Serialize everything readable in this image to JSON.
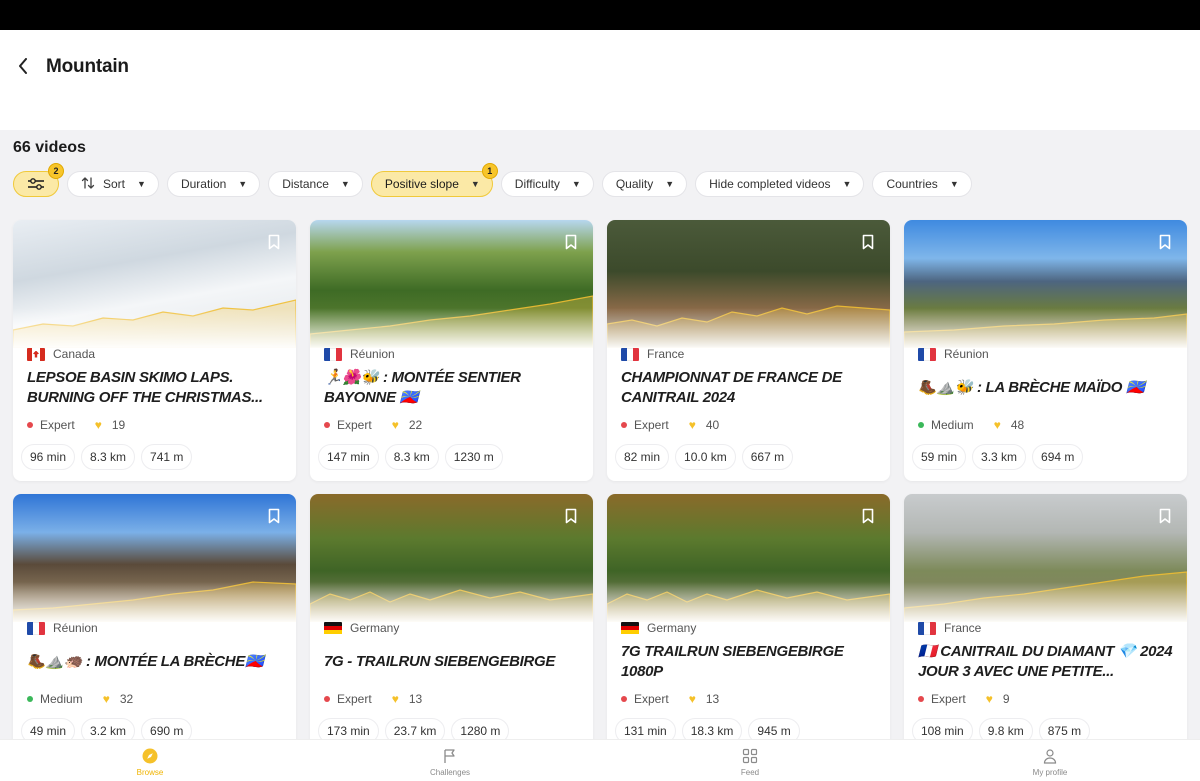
{
  "header": {
    "title": "Mountain"
  },
  "video_count": "66 videos",
  "filters": {
    "settings_badge": "2",
    "chips": [
      {
        "label": "Sort",
        "has_sort_icon": true
      },
      {
        "label": "Duration"
      },
      {
        "label": "Distance"
      },
      {
        "label": "Positive slope",
        "active": true,
        "badge": "1"
      },
      {
        "label": "Difficulty"
      },
      {
        "label": "Quality"
      },
      {
        "label": "Hide completed videos"
      },
      {
        "label": "Countries"
      }
    ]
  },
  "cards": [
    {
      "country": "Canada",
      "flag": "canada",
      "title": "LEPSOE BASIN SKIMO LAPS. BURNING OFF THE CHRISTMAS...",
      "difficulty": "Expert",
      "likes": "19",
      "duration": "96 min",
      "distance": "8.3 km",
      "elevation": "741 m",
      "scene": "snow"
    },
    {
      "country": "Réunion",
      "flag": "france",
      "title": "🏃🌺🐝 : MONTÉE SENTIER BAYONNE 🇷🇪",
      "difficulty": "Expert",
      "likes": "22",
      "duration": "147 min",
      "distance": "8.3 km",
      "elevation": "1230 m",
      "scene": "jungle"
    },
    {
      "country": "France",
      "flag": "france",
      "title": "CHAMPIONNAT DE FRANCE DE CANITRAIL 2024",
      "difficulty": "Expert",
      "likes": "40",
      "duration": "82 min",
      "distance": "10.0 km",
      "elevation": "667 m",
      "scene": "trail"
    },
    {
      "country": "Réunion",
      "flag": "france",
      "title": "🥾⛰️🐝 : LA BRÈCHE MAÏDO 🇷🇪",
      "difficulty": "Medium",
      "likes": "48",
      "duration": "59 min",
      "distance": "3.3 km",
      "elevation": "694 m",
      "scene": "ridge"
    },
    {
      "country": "Réunion",
      "flag": "france",
      "title": "🥾⛰️🦔 : MONTÉE LA BRÈCHE🇷🇪",
      "difficulty": "Medium",
      "likes": "32",
      "duration": "49 min",
      "distance": "3.2 km",
      "elevation": "690 m",
      "scene": "rock"
    },
    {
      "country": "Germany",
      "flag": "germany",
      "title": "7G - TRAILRUN  SIEBENGEBIRGE",
      "difficulty": "Expert",
      "likes": "13",
      "duration": "173 min",
      "distance": "23.7 km",
      "elevation": "1280 m",
      "scene": "forest"
    },
    {
      "country": "Germany",
      "flag": "germany",
      "title": "7G TRAILRUN SIEBENGEBIRGE 1080P",
      "difficulty": "Expert",
      "likes": "13",
      "duration": "131 min",
      "distance": "18.3 km",
      "elevation": "945 m",
      "scene": "forest"
    },
    {
      "country": "France",
      "flag": "france",
      "title": "🇫🇷 CANITRAIL DU DIAMANT 💎 2024 JOUR 3 AVEC UNE PETITE...",
      "difficulty": "Expert",
      "likes": "9",
      "duration": "108 min",
      "distance": "9.8 km",
      "elevation": "875 m",
      "scene": "fog"
    }
  ],
  "colors": {
    "expert": "#e5484d",
    "medium": "#3bb85a",
    "accent": "#f5c12a"
  },
  "bottom_nav": [
    {
      "label": "Browse",
      "icon": "compass-icon",
      "active": true
    },
    {
      "label": "Challenges",
      "icon": "flag-icon"
    },
    {
      "label": "Feed",
      "icon": "grid-icon"
    },
    {
      "label": "My profile",
      "icon": "user-icon"
    }
  ]
}
